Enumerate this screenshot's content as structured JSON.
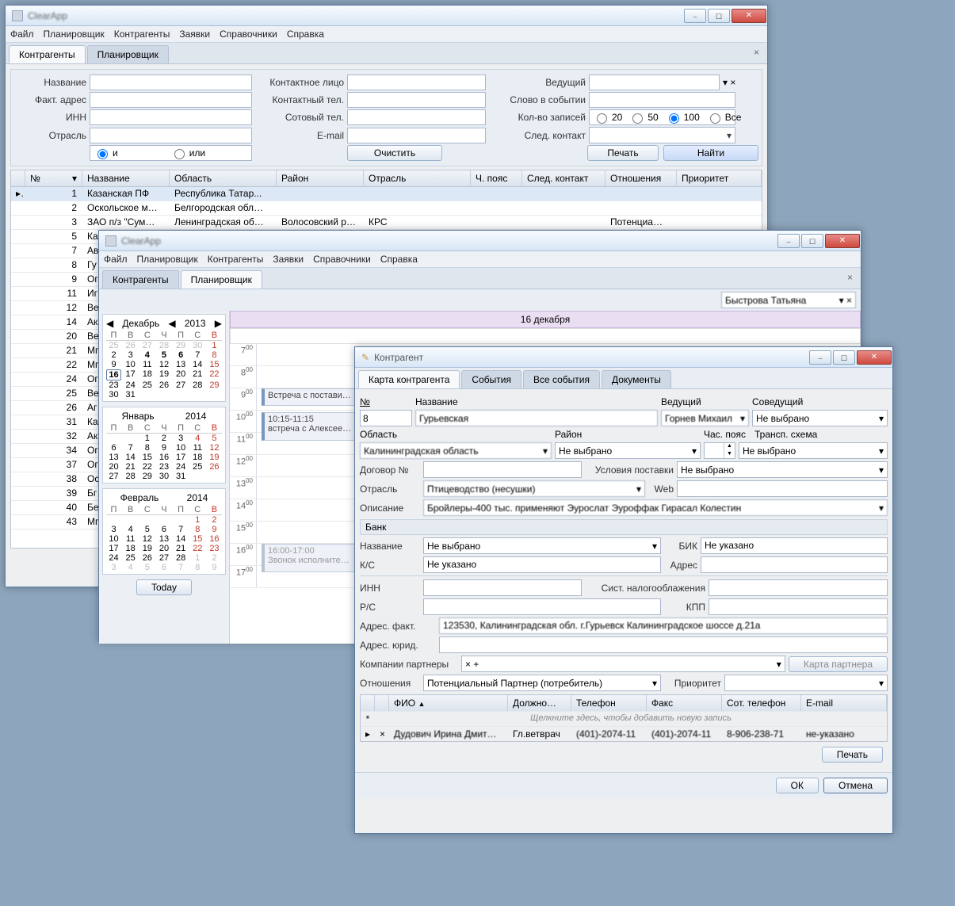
{
  "w1": {
    "menu": [
      "Файл",
      "Планировщик",
      "Контрагенты",
      "Заявки",
      "Справочники",
      "Справка"
    ],
    "tabs": {
      "t0": "Контрагенты",
      "t1": "Планировщик"
    },
    "flt": {
      "name": "Название",
      "addr": "Факт. адрес",
      "inn": "ИНН",
      "ind": "Отрасль",
      "contact": "Контактное лицо",
      "cphone": "Контактный тел.",
      "mphone": "Сотовый тел.",
      "email": "E-mail",
      "lead": "Ведущий",
      "evword": "Слово в событии",
      "cnt": "Кол-во записей",
      "next": "След. контакт",
      "r_and": "и",
      "r_or": "или",
      "r20": "20",
      "r50": "50",
      "r100": "100",
      "rall": "Все",
      "clear": "Очистить",
      "print": "Печать",
      "find": "Найти"
    },
    "cols": {
      "no": "№",
      "name": "Название",
      "obl": "Область",
      "raion": "Район",
      "ind": "Отрасль",
      "tz": "Ч. пояс",
      "next": "След. контакт",
      "rel": "Отношения",
      "prio": "Приоритет"
    },
    "rows": [
      {
        "no": "1",
        "name": "Казанская ПФ",
        "obl": "Республика Татар...",
        "raion": "",
        "ind": "",
        "tz": "",
        "next": "",
        "rel": "",
        "prio": ""
      },
      {
        "no": "2",
        "name": "Оскольское м…",
        "obl": "Белгородская обл…",
        "raion": "",
        "ind": "",
        "tz": "",
        "next": "",
        "rel": "",
        "prio": ""
      },
      {
        "no": "3",
        "name": "ЗАО п/з \"Сум…",
        "obl": "Ленинградская об…",
        "raion": "Волосовский р…",
        "ind": "КРС",
        "tz": "",
        "next": "",
        "rel": "Потенциа…",
        "prio": ""
      },
      {
        "no": "5",
        "name": "Ка",
        "obl": "",
        "raion": "",
        "ind": "",
        "tz": "",
        "next": "",
        "rel": "",
        "prio": ""
      },
      {
        "no": "7",
        "name": "Ав",
        "obl": "",
        "raion": "",
        "ind": "",
        "tz": "",
        "next": "",
        "rel": "",
        "prio": ""
      },
      {
        "no": "8",
        "name": "Гу",
        "obl": "",
        "raion": "",
        "ind": "",
        "tz": "",
        "next": "",
        "rel": "",
        "prio": ""
      },
      {
        "no": "9",
        "name": "Ог",
        "obl": "",
        "raion": "",
        "ind": "",
        "tz": "",
        "next": "",
        "rel": "",
        "prio": ""
      },
      {
        "no": "11",
        "name": "Иг",
        "obl": "",
        "raion": "",
        "ind": "",
        "tz": "",
        "next": "",
        "rel": "",
        "prio": ""
      },
      {
        "no": "12",
        "name": "Ве",
        "obl": "",
        "raion": "",
        "ind": "",
        "tz": "",
        "next": "",
        "rel": "",
        "prio": ""
      },
      {
        "no": "14",
        "name": "Ак",
        "obl": "",
        "raion": "",
        "ind": "",
        "tz": "",
        "next": "",
        "rel": "",
        "prio": ""
      },
      {
        "no": "20",
        "name": "Ве",
        "obl": "",
        "raion": "",
        "ind": "",
        "tz": "",
        "next": "",
        "rel": "",
        "prio": ""
      },
      {
        "no": "21",
        "name": "Мг",
        "obl": "",
        "raion": "",
        "ind": "",
        "tz": "",
        "next": "",
        "rel": "",
        "prio": ""
      },
      {
        "no": "22",
        "name": "Мг",
        "obl": "",
        "raion": "",
        "ind": "",
        "tz": "",
        "next": "",
        "rel": "",
        "prio": ""
      },
      {
        "no": "24",
        "name": "Ог",
        "obl": "",
        "raion": "",
        "ind": "",
        "tz": "",
        "next": "",
        "rel": "",
        "prio": ""
      },
      {
        "no": "25",
        "name": "Ве",
        "obl": "",
        "raion": "",
        "ind": "",
        "tz": "",
        "next": "",
        "rel": "",
        "prio": ""
      },
      {
        "no": "26",
        "name": "Аг",
        "obl": "",
        "raion": "",
        "ind": "",
        "tz": "",
        "next": "",
        "rel": "",
        "prio": ""
      },
      {
        "no": "31",
        "name": "Ка",
        "obl": "",
        "raion": "",
        "ind": "",
        "tz": "",
        "next": "",
        "rel": "",
        "prio": ""
      },
      {
        "no": "32",
        "name": "Ак",
        "obl": "",
        "raion": "",
        "ind": "",
        "tz": "",
        "next": "",
        "rel": "",
        "prio": ""
      },
      {
        "no": "34",
        "name": "Ог",
        "obl": "",
        "raion": "",
        "ind": "",
        "tz": "",
        "next": "",
        "rel": "",
        "prio": ""
      },
      {
        "no": "37",
        "name": "Ог",
        "obl": "",
        "raion": "",
        "ind": "",
        "tz": "",
        "next": "",
        "rel": "",
        "prio": ""
      },
      {
        "no": "38",
        "name": "Ос",
        "obl": "",
        "raion": "",
        "ind": "",
        "tz": "",
        "next": "",
        "rel": "",
        "prio": ""
      },
      {
        "no": "39",
        "name": "Бг",
        "obl": "",
        "raion": "",
        "ind": "",
        "tz": "",
        "next": "",
        "rel": "",
        "prio": ""
      },
      {
        "no": "40",
        "name": "Бе",
        "obl": "",
        "raion": "",
        "ind": "",
        "tz": "",
        "next": "",
        "rel": "",
        "prio": ""
      },
      {
        "no": "43",
        "name": "Мг",
        "obl": "",
        "raion": "",
        "ind": "",
        "tz": "",
        "next": "",
        "rel": "",
        "prio": ""
      }
    ]
  },
  "w2": {
    "menu": [
      "Файл",
      "Планировщик",
      "Контрагенты",
      "Заявки",
      "Справочники",
      "Справка"
    ],
    "tabs": {
      "t0": "Контрагенты",
      "t1": "Планировщик"
    },
    "user": "Быстрова Татьяна",
    "day": "16 декабря",
    "dec": {
      "name": "Декабрь",
      "year": "2013"
    },
    "jan": {
      "name": "Январь",
      "year": "2014"
    },
    "feb": {
      "name": "Февраль",
      "year": "2014"
    },
    "dow": [
      "П",
      "В",
      "С",
      "Ч",
      "П",
      "С",
      "В"
    ],
    "today": "Today",
    "ev1h": "Встреча с постави…",
    "ev2t": "10:15-11:15",
    "ev2": "встреча с Алексее…",
    "ev3t": "16:00-17:00",
    "ev3": "Звонок исполните…"
  },
  "w3": {
    "title": "Контрагент",
    "tabs": {
      "t0": "Карта контрагента",
      "t1": "События",
      "t2": "Все события",
      "t3": "Документы"
    },
    "lbl": {
      "no": "№",
      "name": "Название",
      "lead": "Ведущий",
      "colead": "Соведущий",
      "obl": "Область",
      "raion": "Район",
      "tz": "Час. пояс",
      "transp": "Трансп. схема",
      "contract": "Договор №",
      "delivery": "Условия поставки",
      "ind": "Отрасль",
      "web": "Web",
      "desc": "Описание",
      "bank": "Банк",
      "bankname": "Название",
      "bik": "БИК",
      "ks": "К/С",
      "bankaddr": "Адрес",
      "inn": "ИНН",
      "tax": "Сист. налогооблажения",
      "rs": "Р/С",
      "kpp": "КПП",
      "factaddr": "Адрес. факт.",
      "legaddr": "Адрес. юрид.",
      "partners": "Компании партнеры",
      "partnercard": "Карта партнера",
      "rel": "Отношения",
      "prio": "Приоритет",
      "print": "Печать",
      "ok": "ОК",
      "cancel": "Отмена"
    },
    "val": {
      "no": "8",
      "name": "Гурьевская",
      "lead": "Горнев Михаил",
      "colead": "Не выбрано",
      "obl": "Калининградская область",
      "raion": "Не выбрано",
      "transp": "Не выбрано",
      "delivery": "Не выбрано",
      "ind": "Птицеводство (несушки)",
      "desc": "Бройлеры-400 тыс. применяют Эурослат Эуроффак Гирасал Колестин",
      "bankname": "Не выбрано",
      "bik": "Не указано",
      "ks": "Не указано",
      "factaddr": "123530, Калининградская обл. г.Гурьевск Калининградское шоссе д.21а",
      "rel": "Потенциальный Партнер (потребитель)"
    },
    "ccols": {
      "fio": "ФИО",
      "pos": "Должно…",
      "phone": "Телефон",
      "fax": "Факс",
      "mob": "Сот. телефон",
      "email": "E-mail"
    },
    "cplh": "Щелкните здесь, чтобы добавить новую запись",
    "crow": {
      "fio": "Дудович Ирина Дмит…",
      "pos": "Гл.ветврач",
      "phone": "(401)-2074-11",
      "fax": "(401)-2074-11",
      "mob": "8-906-238-71",
      "email": "не-указано"
    }
  }
}
